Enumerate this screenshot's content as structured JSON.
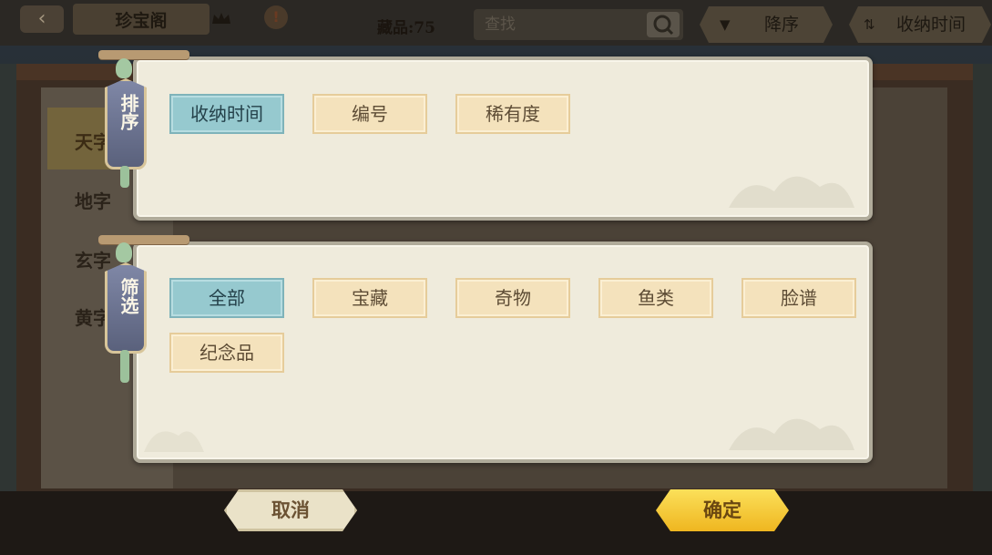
{
  "topbar": {
    "back_icon": "back-arrow-icon",
    "title": "珍宝阁",
    "crown_icon": "crown-icon",
    "alert_icon": "exclamation-icon",
    "collection_count": "藏品:75",
    "search_placeholder": "查找",
    "search_icon": "magnifier-icon",
    "sort_order_label": "降序",
    "sort_order_icon": "triangle-down-icon",
    "sort_field_label": "收纳时间",
    "sort_field_icon": "swap-arrows-icon"
  },
  "side_tabs": [
    "天字",
    "地字",
    "玄字",
    "黄字"
  ],
  "sort_panel": {
    "tag_label": "排序",
    "options": [
      {
        "label": "收纳时间",
        "selected": true
      },
      {
        "label": "编号",
        "selected": false
      },
      {
        "label": "稀有度",
        "selected": false
      }
    ]
  },
  "filter_panel": {
    "tag_label": "筛选",
    "options": [
      {
        "label": "全部",
        "selected": true
      },
      {
        "label": "宝藏",
        "selected": false
      },
      {
        "label": "奇物",
        "selected": false
      },
      {
        "label": "鱼类",
        "selected": false
      },
      {
        "label": "脸谱",
        "selected": false
      },
      {
        "label": "纪念品",
        "selected": false
      }
    ]
  },
  "actions": {
    "cancel_label": "取消",
    "confirm_label": "确定"
  },
  "colors": {
    "selected_option": "#96c9cf",
    "unselected_option": "#f4e2bc",
    "confirm_button": "#f5c93a",
    "panel_background": "#efebdc"
  }
}
